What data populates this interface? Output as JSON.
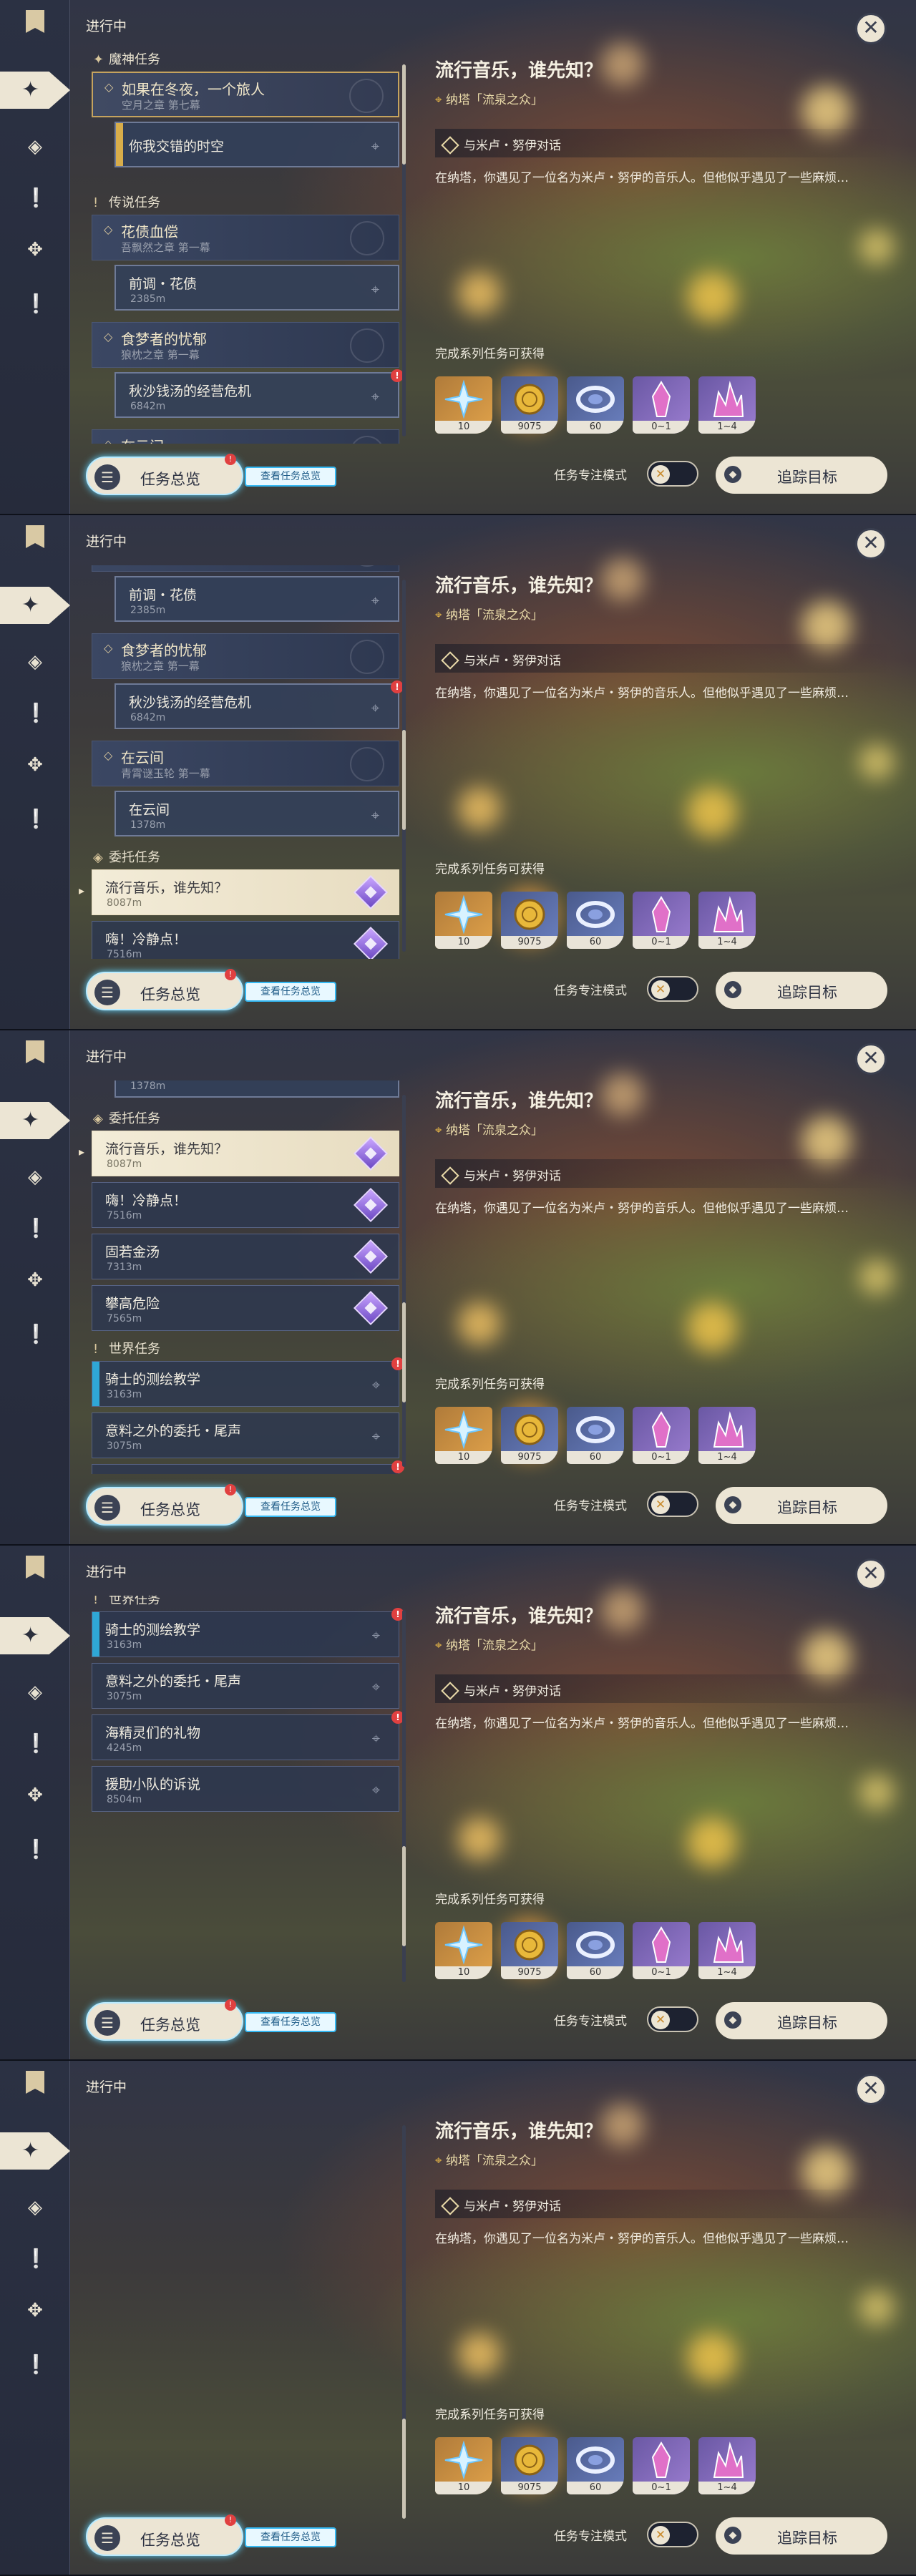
{
  "header": {
    "in_progress": "进行中"
  },
  "rail_icons": [
    "quest-flag-icon",
    "quest-diamond-icon",
    "story-icon",
    "exclamation-icon",
    "compass-icon",
    "exclamation-icon"
  ],
  "categories": {
    "archon": "魔神任务",
    "legend": "传说任务",
    "commission": "委托任务",
    "world": "世界任务"
  },
  "quests": {
    "archon_chain": {
      "title": "如果在冬夜，一个旅人",
      "subtitle": "空月之章 第七幕"
    },
    "archon_task": {
      "name": "你我交错的时空"
    },
    "legend_chain1": {
      "title": "花债血偿",
      "subtitle": "吾飘然之章 第一幕"
    },
    "legend_task1": {
      "name": "前调・花债",
      "dist": "2385m"
    },
    "legend_chain2": {
      "title": "食梦者的忧郁",
      "subtitle": "狼枕之章 第一幕"
    },
    "legend_task2": {
      "name": "秋沙钱汤的经营危机",
      "dist": "6842m"
    },
    "legend_chain3": {
      "title": "在云间",
      "subtitle": "青霄谜玉轮 第一幕"
    },
    "legend_task3": {
      "name": "在云间",
      "dist": "1378m"
    },
    "comm1": {
      "name": "流行音乐，谁先知？",
      "dist": "8087m"
    },
    "comm2": {
      "name": "嗨！冷静点！",
      "dist": "7516m"
    },
    "comm3": {
      "name": "固若金汤",
      "dist": "7313m"
    },
    "comm4": {
      "name": "攀高危险",
      "dist": "7565m"
    },
    "world1": {
      "name": "骑士的测绘教学",
      "dist": "3163m"
    },
    "world2": {
      "name": "意料之外的委托・尾声",
      "dist": "3075m"
    },
    "world3": {
      "name": "海精灵们的礼物",
      "dist": "4245m"
    },
    "world4": {
      "name": "援助小队的诉说",
      "dist": "8504m"
    }
  },
  "detail": {
    "title": "流行音乐，谁先知？",
    "location": "纳塔「流泉之众」",
    "objective": "与米卢・努伊对话",
    "description": "在纳塔，你遇见了一位名为米卢・努伊的音乐人。但他似乎遇见了一些麻烦…",
    "rewards_label": "完成系列任务可获得",
    "rewards": [
      {
        "icon": "adventure-exp-icon",
        "qty": "10"
      },
      {
        "icon": "mora-icon",
        "qty": "9075"
      },
      {
        "icon": "companionship-exp-icon",
        "qty": "60"
      },
      {
        "icon": "crystal-icon",
        "qty": "0~1"
      },
      {
        "icon": "crystal-chunk-icon",
        "qty": "1~4"
      }
    ]
  },
  "bottom": {
    "overview_label": "任务总览",
    "overview_badge": "!",
    "overview_tag": "查看任务总览",
    "focus_label": "任务专注模式",
    "track_label": "追踪目标"
  },
  "colors": {
    "accent_gold": "#c5a35e",
    "world_bar": "#2fa7d6",
    "badge_red": "#e04040"
  }
}
